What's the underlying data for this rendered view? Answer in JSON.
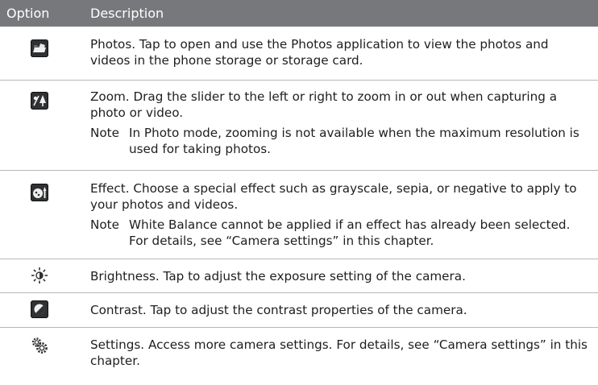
{
  "header": {
    "option": "Option",
    "description": "Description"
  },
  "rows": [
    {
      "icon": "photos-folder-icon",
      "name": "Photos",
      "text": ". Tap to open and use the Photos application to view the photos and videos in the phone storage or storage card."
    },
    {
      "icon": "zoom-icon",
      "name": "Zoom",
      "text": ". Drag the slider to the left or right to zoom in or out when capturing a photo or video.",
      "note_label": "Note",
      "note": "In Photo mode, zooming is not available when the maximum resolution is used for taking photos."
    },
    {
      "icon": "effect-icon",
      "name": "Effect",
      "text": ". Choose a special effect such as grayscale, sepia, or negative to apply to your photos and videos.",
      "note_label": "Note",
      "note": "White Balance cannot be applied if an effect has already been selected. For details, see “Camera settings” in this chapter."
    },
    {
      "icon": "brightness-icon",
      "name": "Brightness",
      "text": ". Tap to adjust the exposure setting of the camera."
    },
    {
      "icon": "contrast-icon",
      "name": "Contrast",
      "text": ". Tap to adjust the contrast properties of the camera."
    },
    {
      "icon": "settings-gears-icon",
      "name": "Settings",
      "text": ". Access more camera settings. For details, see “Camera settings” in this chapter."
    }
  ]
}
